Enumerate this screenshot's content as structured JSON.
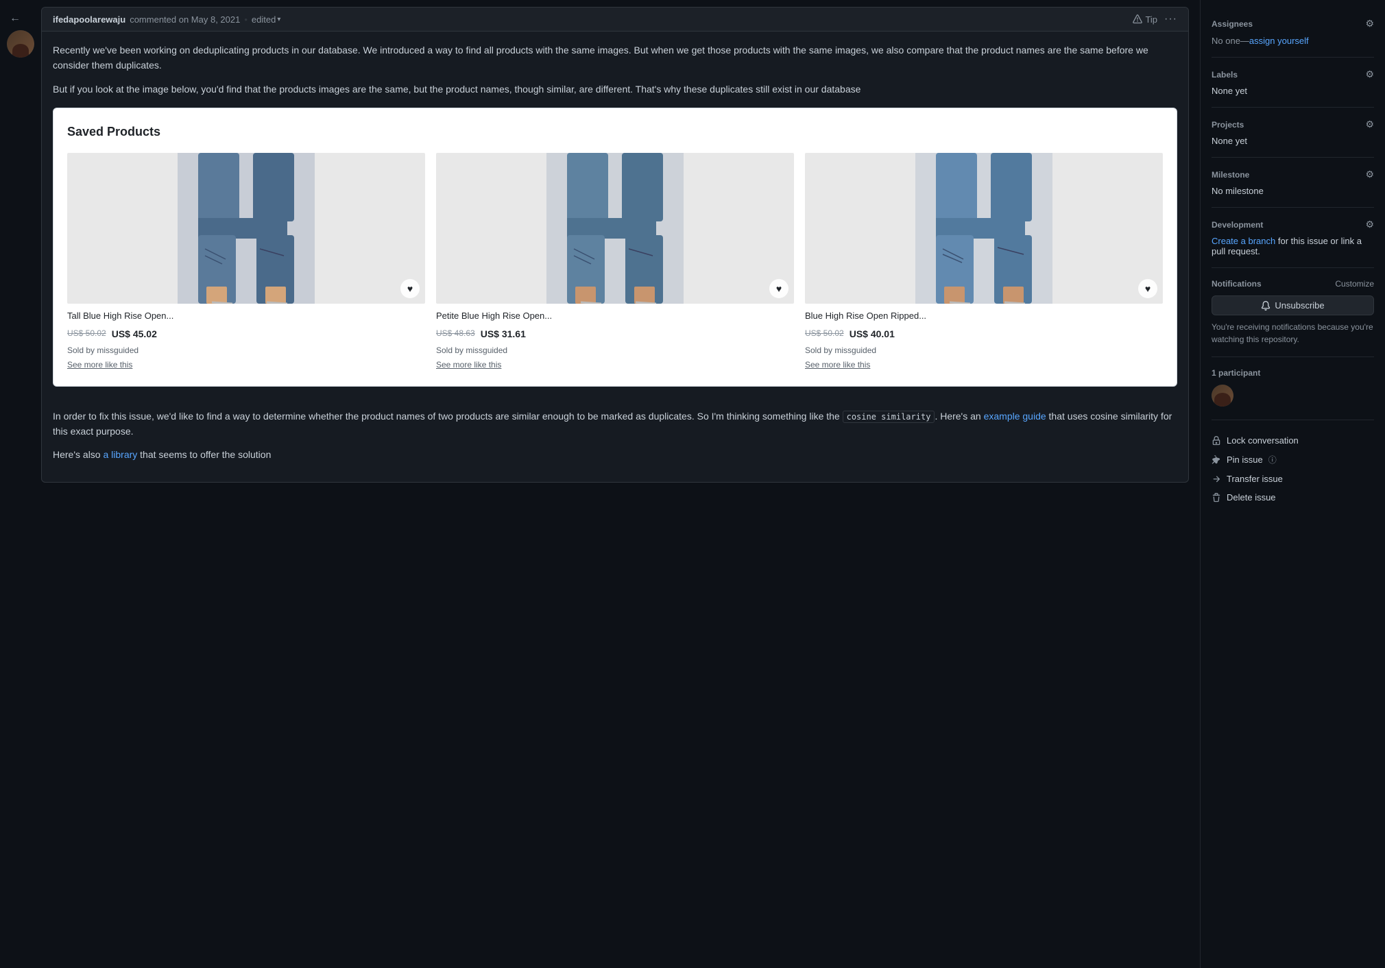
{
  "comment": {
    "username": "ifedapoolarewaju",
    "action": "commented on May 8, 2021",
    "edited_label": "edited",
    "tip_label": "Tip",
    "more_label": "···",
    "body_para1": "Recently we've been working on deduplicating products in our database. We introduced a way to find all products with the same images. But when we get those products with the same images, we also compare that the product names are the same before we consider them duplicates.",
    "body_para2": "But if you look at the image below, you'd find that the products images are the same, but the product names, though similar, are different. That's why these duplicates still exist in our database",
    "saved_products_title": "Saved Products",
    "below_para1_prefix": "In order to fix this issue, we'd like to find a way to determine whether the product names of two products are similar enough to be marked as duplicates. So I'm thinking something like the ",
    "below_para1_code": "cosine similarity",
    "below_para1_middle": ". Here's an ",
    "below_para1_link_text": "example guide",
    "below_para1_suffix": " that uses cosine similarity for this exact purpose.",
    "below_para2_prefix": "Here's also ",
    "below_para2_link_text": "a library",
    "below_para2_suffix": " that seems to offer the solution"
  },
  "products": [
    {
      "name": "Tall Blue High Rise Open...",
      "price_old": "US$ 50.02",
      "price_new": "US$ 45.02",
      "sold_by": "Sold by",
      "seller": "missguided",
      "see_more": "See more like this"
    },
    {
      "name": "Petite Blue High Rise Open...",
      "price_old": "US$ 48.63",
      "price_new": "US$ 31.61",
      "sold_by": "Sold by",
      "seller": "missguided",
      "see_more": "See more like this"
    },
    {
      "name": "Blue High Rise Open Ripped...",
      "price_old": "US$ 50.02",
      "price_new": "US$ 40.01",
      "sold_by": "Sold by",
      "seller": "missguided",
      "see_more": "See more like this"
    }
  ],
  "sidebar": {
    "assignees_title": "Assignees",
    "assignees_value": "No one—",
    "assign_yourself": "assign yourself",
    "labels_title": "Labels",
    "labels_value": "None yet",
    "projects_title": "Projects",
    "projects_value": "None yet",
    "milestone_title": "Milestone",
    "milestone_value": "No milestone",
    "development_title": "Development",
    "development_link_text": "Create a branch",
    "development_suffix": " for this issue or link a pull request.",
    "notifications_title": "Notifications",
    "customize_label": "Customize",
    "unsubscribe_label": "Unsubscribe",
    "notif_description": "You're receiving notifications because you're watching this repository.",
    "participants_title": "1 participant",
    "lock_conversation": "Lock conversation",
    "pin_issue": "Pin issue",
    "transfer_issue": "Transfer issue",
    "delete_issue": "Delete issue"
  }
}
